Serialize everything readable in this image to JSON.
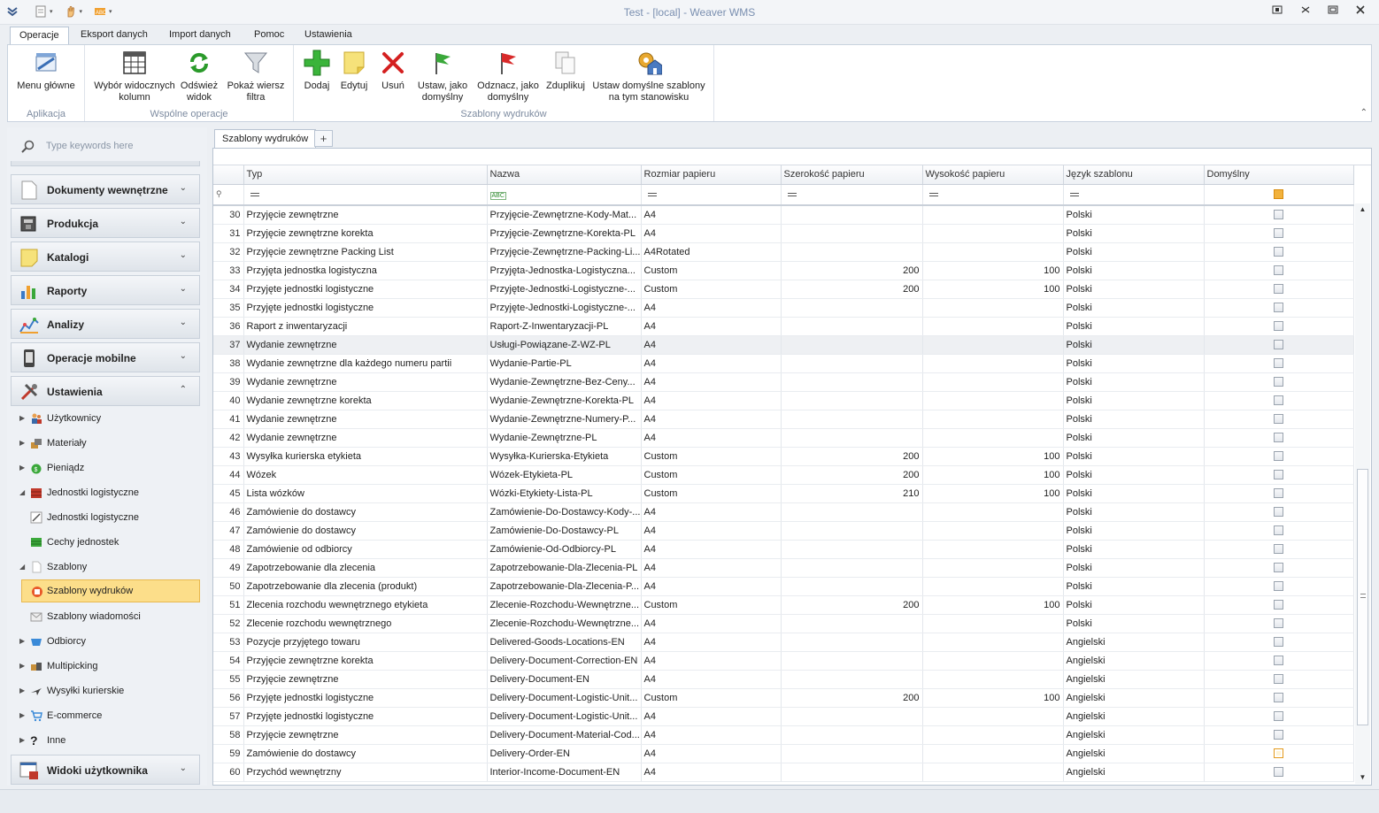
{
  "window": {
    "title": "Test - [local] - Weaver WMS"
  },
  "ribbon_tabs": [
    "Operacje",
    "Eksport danych",
    "Import danych",
    "Pomoc",
    "Ustawienia"
  ],
  "ribbon": {
    "menu_glowne": "Menu główne",
    "aplikacja": "Aplikacja",
    "wybor_kolumn": "Wybór widocznych kolumn",
    "odswiez": "Odśwież widok",
    "pokaz_filtr": "Pokaż wiersz filtra",
    "wspolne_operacje": "Wspólne operacje",
    "dodaj": "Dodaj",
    "edytuj": "Edytuj",
    "usun": "Usuń",
    "ustaw_domyslny": "Ustaw, jako domyślny",
    "odznacz_domyslny": "Odznacz, jako domyślny",
    "zduplikuj": "Zduplikuj",
    "ustaw_domyslne_szablony": "Ustaw domyślne szablony na tym stanowisku",
    "szablony_wydrukow": "Szablony wydruków"
  },
  "nav": {
    "search_placeholder": "Type keywords here",
    "groups": {
      "dokumenty": "Dokumenty wewnętrzne",
      "produkcja": "Produkcja",
      "katalogi": "Katalogi",
      "raporty": "Raporty",
      "analizy": "Analizy",
      "mobilne": "Operacje mobilne",
      "ustawienia": "Ustawienia",
      "widoki": "Widoki użytkownika"
    },
    "items": {
      "uzytkownicy": "Użytkownicy",
      "materialy": "Materiały",
      "pieniadz": "Pieniądz",
      "jednostki_log": "Jednostki logistyczne",
      "jednostki_log_sub": "Jednostki logistyczne",
      "cechy": "Cechy jednostek",
      "szablony": "Szablony",
      "szablony_wydrukow": "Szablony wydruków",
      "szablony_wiadomosci": "Szablony wiadomości",
      "odbiorcy": "Odbiorcy",
      "multipicking": "Multipicking",
      "wysylki": "Wysyłki kurierskie",
      "ecommerce": "E-commerce",
      "inne": "Inne"
    }
  },
  "doc_tab": "Szablony wydruków",
  "add_tab": "+",
  "grid": {
    "columns": [
      "Typ",
      "Nazwa",
      "Rozmiar papieru",
      "Szerokość papieru",
      "Wysokość papieru",
      "Język szablonu",
      "Domyślny"
    ],
    "rows": [
      {
        "n": "30",
        "typ": "Przyjęcie zewnętrzne",
        "nazwa": "Przyjęcie-Zewnętrzne-Kody-Mat...",
        "rozmiar": "A4",
        "szer": "",
        "wys": "",
        "jezyk": "Polski",
        "def": false
      },
      {
        "n": "31",
        "typ": "Przyjęcie zewnętrzne korekta",
        "nazwa": "Przyjęcie-Zewnętrzne-Korekta-PL",
        "rozmiar": "A4",
        "szer": "",
        "wys": "",
        "jezyk": "Polski",
        "def": false
      },
      {
        "n": "32",
        "typ": "Przyjęcie zewnętrzne Packing List",
        "nazwa": "Przyjęcie-Zewnętrzne-Packing-Li...",
        "rozmiar": "A4Rotated",
        "szer": "",
        "wys": "",
        "jezyk": "Polski",
        "def": false
      },
      {
        "n": "33",
        "typ": "Przyjęta jednostka logistyczna",
        "nazwa": "Przyjęta-Jednostka-Logistyczna...",
        "rozmiar": "Custom",
        "szer": "200",
        "wys": "100",
        "jezyk": "Polski",
        "def": false
      },
      {
        "n": "34",
        "typ": "Przyjęte jednostki logistyczne",
        "nazwa": "Przyjęte-Jednostki-Logistyczne-...",
        "rozmiar": "Custom",
        "szer": "200",
        "wys": "100",
        "jezyk": "Polski",
        "def": false
      },
      {
        "n": "35",
        "typ": "Przyjęte jednostki logistyczne",
        "nazwa": "Przyjęte-Jednostki-Logistyczne-...",
        "rozmiar": "A4",
        "szer": "",
        "wys": "",
        "jezyk": "Polski",
        "def": false
      },
      {
        "n": "36",
        "typ": "Raport z inwentaryzacji",
        "nazwa": "Raport-Z-Inwentaryzacji-PL",
        "rozmiar": "A4",
        "szer": "",
        "wys": "",
        "jezyk": "Polski",
        "def": false
      },
      {
        "n": "37",
        "typ": "Wydanie zewnętrzne",
        "nazwa": "Usługi-Powiązane-Z-WZ-PL",
        "rozmiar": "A4",
        "szer": "",
        "wys": "",
        "jezyk": "Polski",
        "def": false
      },
      {
        "n": "38",
        "typ": "Wydanie zewnętrzne dla każdego numeru partii",
        "nazwa": "Wydanie-Partie-PL",
        "rozmiar": "A4",
        "szer": "",
        "wys": "",
        "jezyk": "Polski",
        "def": false
      },
      {
        "n": "39",
        "typ": "Wydanie zewnętrzne",
        "nazwa": "Wydanie-Zewnętrzne-Bez-Ceny...",
        "rozmiar": "A4",
        "szer": "",
        "wys": "",
        "jezyk": "Polski",
        "def": false
      },
      {
        "n": "40",
        "typ": "Wydanie zewnętrzne korekta",
        "nazwa": "Wydanie-Zewnętrzne-Korekta-PL",
        "rozmiar": "A4",
        "szer": "",
        "wys": "",
        "jezyk": "Polski",
        "def": false
      },
      {
        "n": "41",
        "typ": "Wydanie zewnętrzne",
        "nazwa": "Wydanie-Zewnętrzne-Numery-P...",
        "rozmiar": "A4",
        "szer": "",
        "wys": "",
        "jezyk": "Polski",
        "def": false
      },
      {
        "n": "42",
        "typ": "Wydanie zewnętrzne",
        "nazwa": "Wydanie-Zewnętrzne-PL",
        "rozmiar": "A4",
        "szer": "",
        "wys": "",
        "jezyk": "Polski",
        "def": false
      },
      {
        "n": "43",
        "typ": "Wysyłka kurierska etykieta",
        "nazwa": "Wysyłka-Kurierska-Etykieta",
        "rozmiar": "Custom",
        "szer": "200",
        "wys": "100",
        "jezyk": "Polski",
        "def": false
      },
      {
        "n": "44",
        "typ": "Wózek",
        "nazwa": "Wózek-Etykieta-PL",
        "rozmiar": "Custom",
        "szer": "200",
        "wys": "100",
        "jezyk": "Polski",
        "def": false
      },
      {
        "n": "45",
        "typ": "Lista wózków",
        "nazwa": "Wózki-Etykiety-Lista-PL",
        "rozmiar": "Custom",
        "szer": "210",
        "wys": "100",
        "jezyk": "Polski",
        "def": false
      },
      {
        "n": "46",
        "typ": "Zamówienie do dostawcy",
        "nazwa": "Zamówienie-Do-Dostawcy-Kody-...",
        "rozmiar": "A4",
        "szer": "",
        "wys": "",
        "jezyk": "Polski",
        "def": false
      },
      {
        "n": "47",
        "typ": "Zamówienie do dostawcy",
        "nazwa": "Zamówienie-Do-Dostawcy-PL",
        "rozmiar": "A4",
        "szer": "",
        "wys": "",
        "jezyk": "Polski",
        "def": false
      },
      {
        "n": "48",
        "typ": "Zamówienie od odbiorcy",
        "nazwa": "Zamówienie-Od-Odbiorcy-PL",
        "rozmiar": "A4",
        "szer": "",
        "wys": "",
        "jezyk": "Polski",
        "def": false
      },
      {
        "n": "49",
        "typ": "Zapotrzebowanie dla zlecenia",
        "nazwa": "Zapotrzebowanie-Dla-Zlecenia-PL",
        "rozmiar": "A4",
        "szer": "",
        "wys": "",
        "jezyk": "Polski",
        "def": false
      },
      {
        "n": "50",
        "typ": "Zapotrzebowanie dla zlecenia (produkt)",
        "nazwa": "Zapotrzebowanie-Dla-Zlecenia-P...",
        "rozmiar": "A4",
        "szer": "",
        "wys": "",
        "jezyk": "Polski",
        "def": false
      },
      {
        "n": "51",
        "typ": "Zlecenia rozchodu wewnętrznego etykieta",
        "nazwa": "Zlecenie-Rozchodu-Wewnętrzne...",
        "rozmiar": "Custom",
        "szer": "200",
        "wys": "100",
        "jezyk": "Polski",
        "def": false
      },
      {
        "n": "52",
        "typ": "Zlecenie rozchodu wewnętrznego",
        "nazwa": "Zlecenie-Rozchodu-Wewnętrzne...",
        "rozmiar": "A4",
        "szer": "",
        "wys": "",
        "jezyk": "Polski",
        "def": false
      },
      {
        "n": "53",
        "typ": "Pozycje przyjętego towaru",
        "nazwa": "Delivered-Goods-Locations-EN",
        "rozmiar": "A4",
        "szer": "",
        "wys": "",
        "jezyk": "Angielski",
        "def": false
      },
      {
        "n": "54",
        "typ": "Przyjęcie zewnętrzne korekta",
        "nazwa": "Delivery-Document-Correction-EN",
        "rozmiar": "A4",
        "szer": "",
        "wys": "",
        "jezyk": "Angielski",
        "def": false
      },
      {
        "n": "55",
        "typ": "Przyjęcie zewnętrzne",
        "nazwa": "Delivery-Document-EN",
        "rozmiar": "A4",
        "szer": "",
        "wys": "",
        "jezyk": "Angielski",
        "def": false
      },
      {
        "n": "56",
        "typ": "Przyjęte jednostki logistyczne",
        "nazwa": "Delivery-Document-Logistic-Unit...",
        "rozmiar": "Custom",
        "szer": "200",
        "wys": "100",
        "jezyk": "Angielski",
        "def": false
      },
      {
        "n": "57",
        "typ": "Przyjęte jednostki logistyczne",
        "nazwa": "Delivery-Document-Logistic-Unit...",
        "rozmiar": "A4",
        "szer": "",
        "wys": "",
        "jezyk": "Angielski",
        "def": false
      },
      {
        "n": "58",
        "typ": "Przyjęcie zewnętrzne",
        "nazwa": "Delivery-Document-Material-Cod...",
        "rozmiar": "A4",
        "szer": "",
        "wys": "",
        "jezyk": "Angielski",
        "def": false
      },
      {
        "n": "59",
        "typ": "Zamówienie do dostawcy",
        "nazwa": "Delivery-Order-EN",
        "rozmiar": "A4",
        "szer": "",
        "wys": "",
        "jezyk": "Angielski",
        "def": true
      },
      {
        "n": "60",
        "typ": "Przychód wewnętrzny",
        "nazwa": "Interior-Income-Document-EN",
        "rozmiar": "A4",
        "szer": "",
        "wys": "",
        "jezyk": "Angielski",
        "def": false
      }
    ]
  },
  "colors": {
    "selected_nav": "#fcde8a",
    "checkbox_checked": "#e49b1d"
  }
}
